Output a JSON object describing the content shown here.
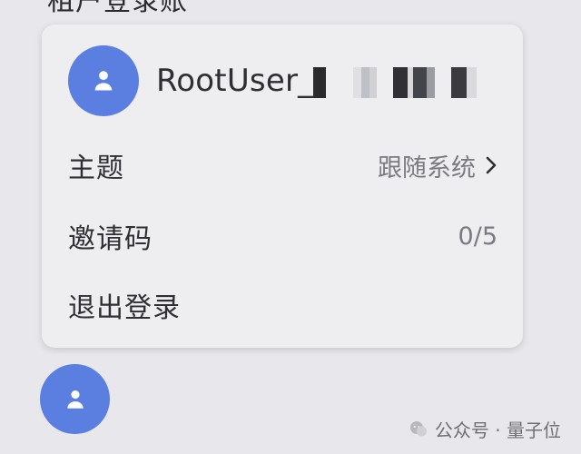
{
  "top_cut_text": "租户登录账",
  "account": {
    "username": "RootUser_"
  },
  "menu": {
    "theme": {
      "label": "主题",
      "value": "跟随系统"
    },
    "invite": {
      "label": "邀请码",
      "value": "0/5"
    },
    "logout": {
      "label": "退出登录"
    }
  },
  "watermark": {
    "text": "公众号 · 量子位"
  },
  "colors": {
    "background": "#e8e8ec",
    "card": "#eeeef1",
    "avatar": "#5b7fe0",
    "primary_text": "#2f2f33",
    "secondary_text": "#7a7a80"
  },
  "icons": {
    "avatar": "user-icon",
    "chevron": "chevron-right-icon",
    "watermark": "wechat-icon"
  }
}
